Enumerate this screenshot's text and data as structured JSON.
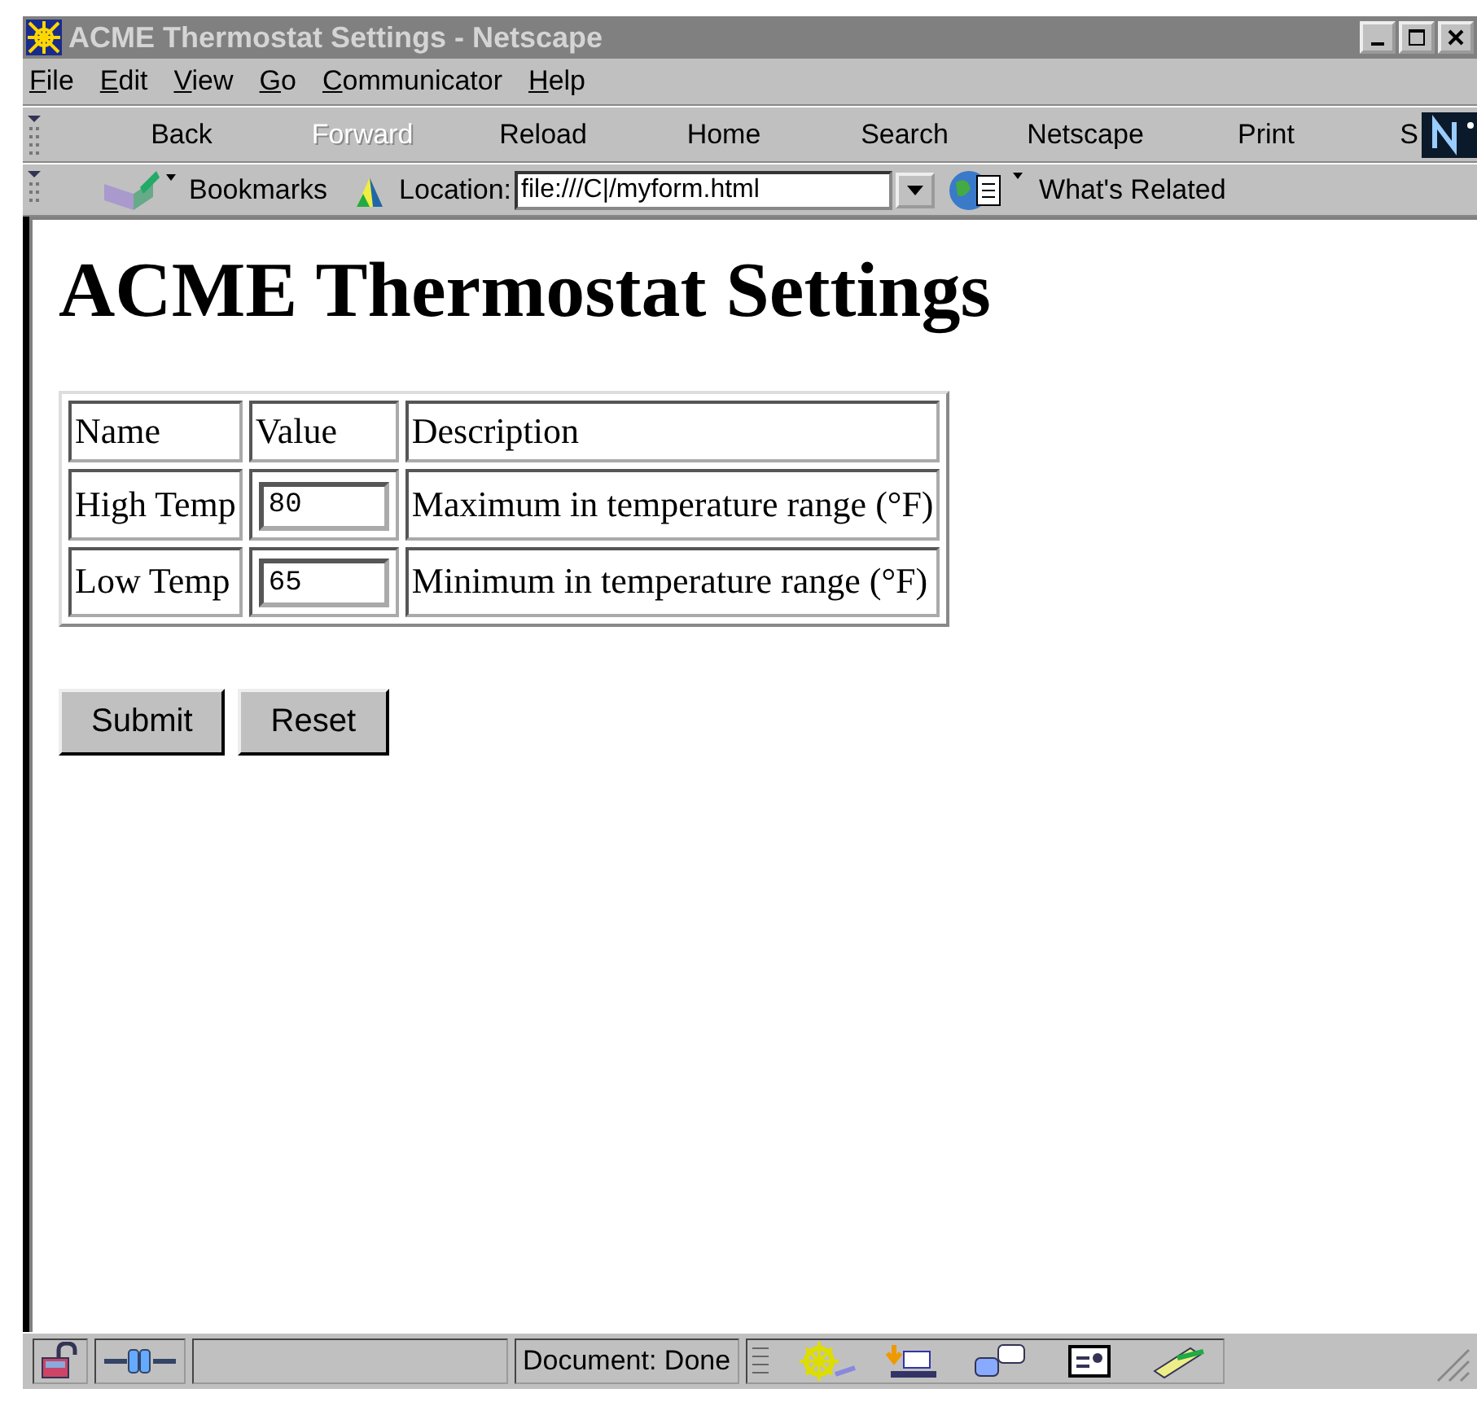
{
  "window": {
    "title": "ACME Thermostat Settings - Netscape"
  },
  "menu": [
    "File",
    "Edit",
    "View",
    "Go",
    "Communicator",
    "Help"
  ],
  "toolbar": [
    {
      "label": "Back",
      "disabled": false
    },
    {
      "label": "Forward",
      "disabled": true
    },
    {
      "label": "Reload",
      "disabled": false
    },
    {
      "label": "Home",
      "disabled": false
    },
    {
      "label": "Search",
      "disabled": false
    },
    {
      "label": "Netscape",
      "disabled": false
    },
    {
      "label": "Print",
      "disabled": false
    },
    {
      "label": "S",
      "disabled": false
    }
  ],
  "location_bar": {
    "bookmarks": "Bookmarks",
    "label": "Location:",
    "url": "file:///C|/myform.html",
    "related": "What's Related"
  },
  "page": {
    "heading": "ACME Thermostat Settings",
    "table": {
      "columns": [
        "Name",
        "Value",
        "Description"
      ],
      "rows": [
        {
          "name": "High Temp",
          "value": "80",
          "description": "Maximum in temperature range (°F)"
        },
        {
          "name": "Low Temp",
          "value": "65",
          "description": "Minimum in temperature range (°F)"
        }
      ]
    },
    "buttons": [
      "Submit",
      "Reset"
    ]
  },
  "status_bar": {
    "text": "Document: Done"
  }
}
